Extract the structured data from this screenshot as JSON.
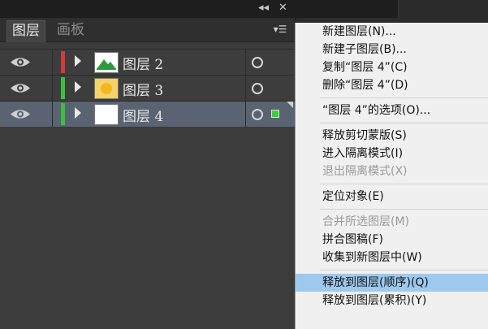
{
  "panel": {
    "tabs": [
      {
        "label": "图层",
        "active": true
      },
      {
        "label": "画板",
        "active": false
      }
    ],
    "controls": {
      "collapse": "◂◂",
      "close": "✕",
      "menu": "▾☰"
    }
  },
  "layers": [
    {
      "name": "图层 2",
      "color": "#d23c3c",
      "thumb": "mountain-thumbnail",
      "selected": false
    },
    {
      "name": "图层 3",
      "color": "#3dbf3d",
      "thumb": "sun-thumbnail",
      "selected": false
    },
    {
      "name": "图层 4",
      "color": "#3dbf3d",
      "thumb": "blank-thumbnail",
      "selected": true
    }
  ],
  "menu": {
    "items": [
      {
        "label": "新建图层(N)...",
        "disabled": false
      },
      {
        "label": "新建子图层(B)...",
        "disabled": false
      },
      {
        "label": "复制“图层 4”(C)",
        "disabled": false
      },
      {
        "label": "删除“图层 4”(D)",
        "disabled": false
      },
      {
        "separator": true
      },
      {
        "label": "“图层 4”的选项(O)...",
        "disabled": false
      },
      {
        "separator": true
      },
      {
        "label": "释放剪切蒙版(S)",
        "disabled": false
      },
      {
        "label": "进入隔离模式(I)",
        "disabled": false
      },
      {
        "label": "退出隔离模式(X)",
        "disabled": true
      },
      {
        "separator": true
      },
      {
        "label": "定位对象(E)",
        "disabled": false
      },
      {
        "separator": true
      },
      {
        "label": "合并所选图层(M)",
        "disabled": true
      },
      {
        "label": "拼合图稿(F)",
        "disabled": false
      },
      {
        "label": "收集到新图层中(W)",
        "disabled": false
      },
      {
        "separator": true
      },
      {
        "label": "释放到图层(顺序)(Q)",
        "disabled": false,
        "highlighted": true
      },
      {
        "label": "释放到图层(累积)(Y)",
        "disabled": false
      }
    ]
  }
}
